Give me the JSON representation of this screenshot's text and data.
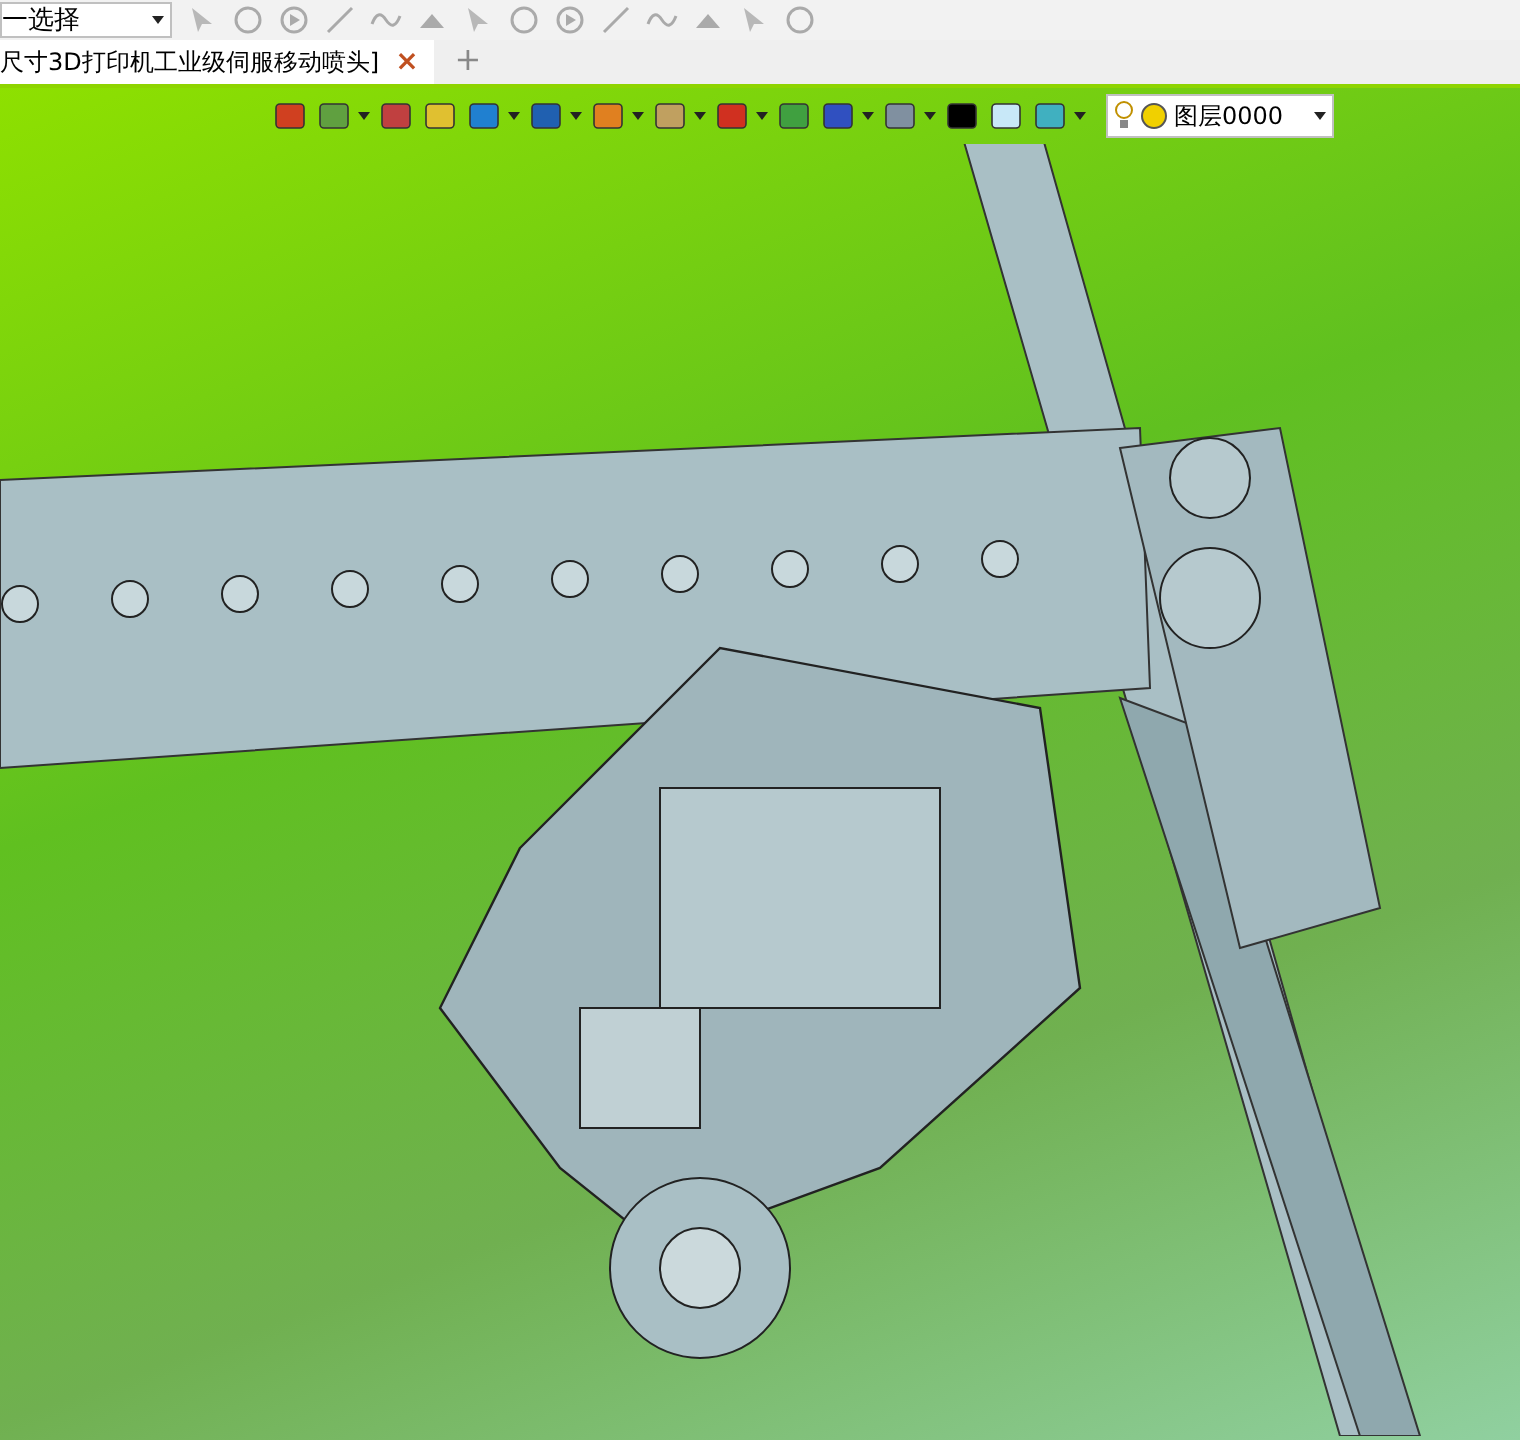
{
  "select_dropdown": {
    "value": "一选择"
  },
  "document_tab": {
    "title": "尺寸3D打印机工业级伺服移动喷头]",
    "close": "×",
    "selected": true
  },
  "new_tab": "+",
  "layer_dropdown": {
    "value": "图层0000"
  }
}
